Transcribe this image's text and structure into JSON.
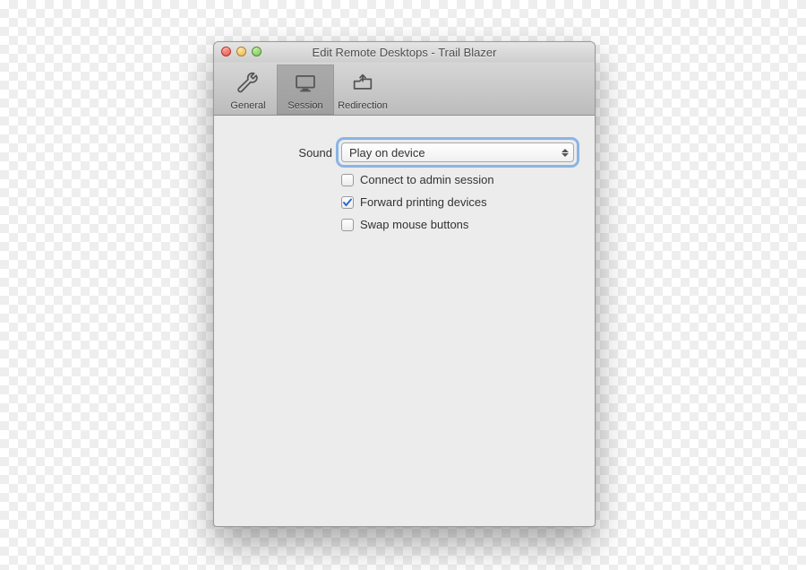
{
  "window": {
    "title": "Edit Remote Desktops - Trail Blazer"
  },
  "toolbar": {
    "tabs": [
      {
        "id": "general",
        "label": "General",
        "icon": "wrench-icon",
        "selected": false
      },
      {
        "id": "session",
        "label": "Session",
        "icon": "monitor-icon",
        "selected": true
      },
      {
        "id": "redirection",
        "label": "Redirection",
        "icon": "folder-arrow-icon",
        "selected": false
      }
    ]
  },
  "form": {
    "sound": {
      "label": "Sound",
      "value": "Play on device"
    },
    "checkboxes": [
      {
        "id": "connect_admin",
        "label": "Connect to admin session",
        "checked": false
      },
      {
        "id": "forward_print",
        "label": "Forward printing devices",
        "checked": true
      },
      {
        "id": "swap_mouse",
        "label": "Swap mouse buttons",
        "checked": false
      }
    ]
  },
  "colors": {
    "focus_ring": "#8ab4e5",
    "check_mark": "#2a6bcf",
    "content_bg": "#ececec"
  }
}
